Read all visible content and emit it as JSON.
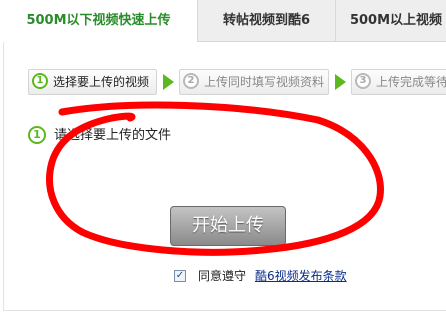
{
  "tabs": [
    {
      "label": "500M以下视频快速上传",
      "active": true
    },
    {
      "label": "转帖视频到酷6",
      "active": false
    },
    {
      "label": "500M以上视频",
      "active": false
    }
  ],
  "steps": [
    {
      "number": "1",
      "label": "选择要上传的视频",
      "active": true
    },
    {
      "number": "2",
      "label": "上传同时填写视频资料",
      "active": false
    },
    {
      "number": "3",
      "label": "上传完成等待",
      "active": false
    }
  ],
  "select_file": {
    "number": "1",
    "label": "请选择要上传的文件"
  },
  "start_button": {
    "label": "开始上传"
  },
  "agreement": {
    "checked": true,
    "check_mark": "✓",
    "label": "同意遵守",
    "link": "酷6视频发布条款"
  },
  "colors": {
    "accent": "#5cb81c",
    "tab_active_text": "#2a8c2a",
    "annotation_stroke": "#ff0000",
    "link": "#0a2f8a"
  }
}
